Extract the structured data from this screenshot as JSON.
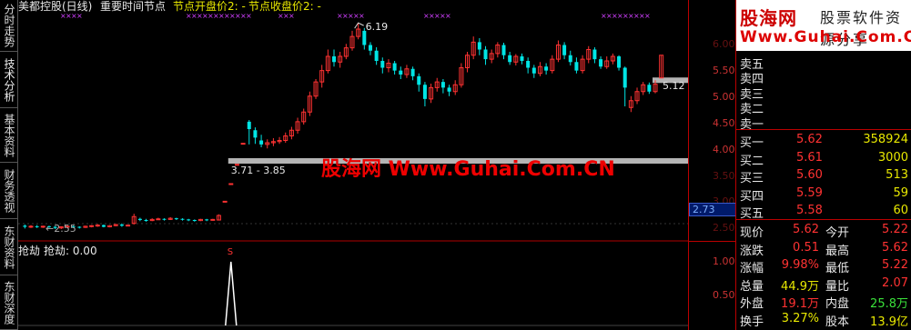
{
  "tabs": [
    {
      "label": "分时走势",
      "active": false
    },
    {
      "label": "技术分析",
      "active": true
    },
    {
      "label": "基本资料",
      "active": false
    },
    {
      "label": "财务透视",
      "active": false
    },
    {
      "label": "东财资料",
      "active": false
    },
    {
      "label": "东财深度",
      "active": false
    }
  ],
  "header": {
    "stock": "美都控股(日线)",
    "indicator": "重要时间节点",
    "open_node": "节点开盘价2: -",
    "close_node": "节点收盘价2: -"
  },
  "sub_header": {
    "name": "抢劫",
    "value": "抢劫: 0.00"
  },
  "annotations": {
    "high": "6.19",
    "low": "2.55",
    "right_mark": "5.12",
    "band_range": "3.71 - 3.85",
    "axis_marker": "2.73",
    "signal": "S"
  },
  "y_ticks": [
    "5.50",
    "5.00",
    "4.50",
    "4.00"
  ],
  "y_ticks_faint": [
    "6.00",
    "3.50",
    "3.00",
    "2.50"
  ],
  "lower_ticks": [
    "1.00",
    "0.50"
  ],
  "watermark": "股海网 Www.Guhai.Com.CN",
  "logo": {
    "title": "股海网",
    "slogan": "股票软件资源分享",
    "url": "Www.Guhai.Com.CN"
  },
  "order_book": {
    "asks": [
      {
        "label": "卖五",
        "price": "",
        "vol": ""
      },
      {
        "label": "卖四",
        "price": "",
        "vol": ""
      },
      {
        "label": "卖三",
        "price": "",
        "vol": ""
      },
      {
        "label": "卖二",
        "price": "",
        "vol": ""
      },
      {
        "label": "卖一",
        "price": "",
        "vol": ""
      }
    ],
    "bids": [
      {
        "label": "买一",
        "price": "5.62",
        "vol": "358924"
      },
      {
        "label": "买二",
        "price": "5.61",
        "vol": "3000"
      },
      {
        "label": "买三",
        "price": "5.60",
        "vol": "513"
      },
      {
        "label": "买四",
        "price": "5.59",
        "vol": "59"
      },
      {
        "label": "买五",
        "price": "5.58",
        "vol": "60"
      }
    ]
  },
  "quote": [
    {
      "l1": "现价",
      "v1": "5.62",
      "l2": "今开",
      "v2": "5.22"
    },
    {
      "l1": "涨跌",
      "v1": "0.51",
      "l2": "最高",
      "v2": "5.62"
    },
    {
      "l1": "涨幅",
      "v1": "9.98%",
      "l2": "最低",
      "v2": "5.22"
    },
    {
      "l1": "总量",
      "v1": "44.9万",
      "l2": "量比",
      "v2": "2.07"
    },
    {
      "l1": "外盘",
      "v1": "19.1万",
      "l2": "内盘",
      "v2": "25.8万"
    },
    {
      "l1": "换手",
      "v1": "3.27%",
      "l2": "股本",
      "v2": "13.9亿"
    }
  ],
  "colors": {
    "up": "#ff3232",
    "down": "#00e5e5",
    "label": "#e8e8e8",
    "axis": "#b00000",
    "yellow": "#e8e800",
    "purple": "#d040ff",
    "gray_band": "#b4b4b4"
  },
  "chart_data": {
    "type": "candlestick",
    "ylim": [
      2.4,
      6.4
    ],
    "candles": [
      {
        "o": 2.62,
        "c": 2.6,
        "h": 2.64,
        "l": 2.57
      },
      {
        "o": 2.6,
        "c": 2.61,
        "h": 2.63,
        "l": 2.58
      },
      {
        "o": 2.61,
        "c": 2.6,
        "h": 2.63,
        "l": 2.58
      },
      {
        "o": 2.6,
        "c": 2.61,
        "h": 2.62,
        "l": 2.58
      },
      {
        "o": 2.61,
        "c": 2.6,
        "h": 2.62,
        "l": 2.58
      },
      {
        "o": 2.6,
        "c": 2.58,
        "h": 2.61,
        "l": 2.56
      },
      {
        "o": 2.58,
        "c": 2.6,
        "h": 2.61,
        "l": 2.56
      },
      {
        "o": 2.6,
        "c": 2.61,
        "h": 2.62,
        "l": 2.58
      },
      {
        "o": 2.61,
        "c": 2.6,
        "h": 2.62,
        "l": 2.58
      },
      {
        "o": 2.6,
        "c": 2.59,
        "h": 2.61,
        "l": 2.57
      },
      {
        "o": 2.59,
        "c": 2.61,
        "h": 2.62,
        "l": 2.58
      },
      {
        "o": 2.61,
        "c": 2.62,
        "h": 2.63,
        "l": 2.59
      },
      {
        "o": 2.62,
        "c": 2.63,
        "h": 2.65,
        "l": 2.6
      },
      {
        "o": 2.63,
        "c": 2.6,
        "h": 2.64,
        "l": 2.59
      },
      {
        "o": 2.6,
        "c": 2.62,
        "h": 2.63,
        "l": 2.59
      },
      {
        "o": 2.62,
        "c": 2.64,
        "h": 2.65,
        "l": 2.61
      },
      {
        "o": 2.64,
        "c": 2.62,
        "h": 2.66,
        "l": 2.6
      },
      {
        "o": 2.62,
        "c": 2.63,
        "h": 2.64,
        "l": 2.61
      },
      {
        "o": 2.66,
        "c": 2.78,
        "h": 2.83,
        "l": 2.64
      },
      {
        "o": 2.74,
        "c": 2.72,
        "h": 2.76,
        "l": 2.7
      },
      {
        "o": 2.72,
        "c": 2.71,
        "h": 2.74,
        "l": 2.69
      },
      {
        "o": 2.71,
        "c": 2.73,
        "h": 2.75,
        "l": 2.7
      },
      {
        "o": 2.73,
        "c": 2.74,
        "h": 2.76,
        "l": 2.72
      },
      {
        "o": 2.74,
        "c": 2.73,
        "h": 2.75,
        "l": 2.71
      },
      {
        "o": 2.73,
        "c": 2.75,
        "h": 2.77,
        "l": 2.72
      },
      {
        "o": 2.75,
        "c": 2.74,
        "h": 2.76,
        "l": 2.72
      },
      {
        "o": 2.74,
        "c": 2.73,
        "h": 2.75,
        "l": 2.71
      },
      {
        "o": 2.73,
        "c": 2.72,
        "h": 2.74,
        "l": 2.7
      },
      {
        "o": 2.72,
        "c": 2.71,
        "h": 2.73,
        "l": 2.69
      },
      {
        "o": 2.71,
        "c": 2.73,
        "h": 2.74,
        "l": 2.7
      },
      {
        "o": 2.73,
        "c": 2.72,
        "h": 2.74,
        "l": 2.7
      },
      {
        "o": 2.72,
        "c": 2.73,
        "h": 2.74,
        "l": 2.71
      },
      {
        "o": 2.72,
        "c": 2.8,
        "h": 2.82,
        "l": 2.71
      },
      {
        "o": 3.05,
        "c": 3.05,
        "h": 3.05,
        "l": 3.05
      },
      {
        "o": 3.36,
        "c": 3.36,
        "h": 3.36,
        "l": 3.36
      },
      {
        "o": 3.7,
        "c": 3.7,
        "h": 3.7,
        "l": 3.7
      },
      {
        "o": 4.07,
        "c": 4.07,
        "h": 4.07,
        "l": 4.07
      },
      {
        "o": 4.45,
        "c": 4.32,
        "h": 4.48,
        "l": 4.05
      },
      {
        "o": 4.3,
        "c": 4.17,
        "h": 4.35,
        "l": 4.06
      },
      {
        "o": 4.12,
        "c": 4.05,
        "h": 4.22,
        "l": 4.0
      },
      {
        "o": 4.05,
        "c": 4.08,
        "h": 4.14,
        "l": 3.98
      },
      {
        "o": 4.08,
        "c": 4.1,
        "h": 4.16,
        "l": 4.02
      },
      {
        "o": 4.1,
        "c": 4.12,
        "h": 4.18,
        "l": 4.06
      },
      {
        "o": 4.12,
        "c": 4.2,
        "h": 4.26,
        "l": 4.08
      },
      {
        "o": 4.2,
        "c": 4.3,
        "h": 4.36,
        "l": 4.14
      },
      {
        "o": 4.3,
        "c": 4.45,
        "h": 4.52,
        "l": 4.24
      },
      {
        "o": 4.45,
        "c": 4.62,
        "h": 4.68,
        "l": 4.4
      },
      {
        "o": 4.62,
        "c": 4.9,
        "h": 4.98,
        "l": 4.55
      },
      {
        "o": 4.9,
        "c": 5.15,
        "h": 5.2,
        "l": 4.85
      },
      {
        "o": 5.15,
        "c": 5.35,
        "h": 5.45,
        "l": 5.05
      },
      {
        "o": 5.35,
        "c": 5.6,
        "h": 5.72,
        "l": 5.3
      },
      {
        "o": 5.6,
        "c": 5.5,
        "h": 5.72,
        "l": 5.42
      },
      {
        "o": 5.5,
        "c": 5.6,
        "h": 5.68,
        "l": 5.4
      },
      {
        "o": 5.6,
        "c": 5.75,
        "h": 5.82,
        "l": 5.55
      },
      {
        "o": 5.75,
        "c": 5.95,
        "h": 6.05,
        "l": 5.7
      },
      {
        "o": 5.95,
        "c": 6.08,
        "h": 6.19,
        "l": 5.9
      },
      {
        "o": 6.05,
        "c": 5.8,
        "h": 6.1,
        "l": 5.72
      },
      {
        "o": 5.8,
        "c": 5.7,
        "h": 5.85,
        "l": 5.62
      },
      {
        "o": 5.7,
        "c": 5.52,
        "h": 5.76,
        "l": 5.45
      },
      {
        "o": 5.52,
        "c": 5.4,
        "h": 5.58,
        "l": 5.3
      },
      {
        "o": 5.4,
        "c": 5.48,
        "h": 5.55,
        "l": 5.32
      },
      {
        "o": 5.48,
        "c": 5.35,
        "h": 5.52,
        "l": 5.28
      },
      {
        "o": 5.35,
        "c": 5.28,
        "h": 5.42,
        "l": 5.2
      },
      {
        "o": 5.28,
        "c": 5.38,
        "h": 5.45,
        "l": 5.22
      },
      {
        "o": 5.38,
        "c": 5.25,
        "h": 5.42,
        "l": 5.18
      },
      {
        "o": 5.25,
        "c": 5.1,
        "h": 5.3,
        "l": 4.98
      },
      {
        "o": 5.1,
        "c": 4.85,
        "h": 5.15,
        "l": 4.72
      },
      {
        "o": 4.85,
        "c": 5.05,
        "h": 5.12,
        "l": 4.78
      },
      {
        "o": 5.05,
        "c": 5.15,
        "h": 5.22,
        "l": 4.98
      },
      {
        "o": 5.15,
        "c": 5.05,
        "h": 5.2,
        "l": 4.95
      },
      {
        "o": 5.05,
        "c": 4.98,
        "h": 5.1,
        "l": 4.9
      },
      {
        "o": 4.98,
        "c": 5.1,
        "h": 5.18,
        "l": 4.92
      },
      {
        "o": 5.1,
        "c": 5.4,
        "h": 5.48,
        "l": 5.05
      },
      {
        "o": 5.4,
        "c": 5.62,
        "h": 5.68,
        "l": 5.32
      },
      {
        "o": 5.62,
        "c": 5.85,
        "h": 5.95,
        "l": 5.55
      },
      {
        "o": 5.85,
        "c": 5.72,
        "h": 5.92,
        "l": 5.62
      },
      {
        "o": 5.72,
        "c": 5.55,
        "h": 5.78,
        "l": 5.45
      },
      {
        "o": 5.55,
        "c": 5.65,
        "h": 5.72,
        "l": 5.48
      },
      {
        "o": 5.65,
        "c": 5.8,
        "h": 5.85,
        "l": 5.58
      },
      {
        "o": 5.8,
        "c": 5.62,
        "h": 5.84,
        "l": 5.55
      },
      {
        "o": 5.62,
        "c": 5.5,
        "h": 5.68,
        "l": 5.45
      },
      {
        "o": 5.5,
        "c": 5.6,
        "h": 5.64,
        "l": 5.44
      },
      {
        "o": 5.6,
        "c": 5.52,
        "h": 5.65,
        "l": 5.46
      },
      {
        "o": 5.52,
        "c": 5.4,
        "h": 5.58,
        "l": 5.3
      },
      {
        "o": 5.4,
        "c": 5.3,
        "h": 5.45,
        "l": 5.22
      },
      {
        "o": 5.3,
        "c": 5.42,
        "h": 5.5,
        "l": 5.25
      },
      {
        "o": 5.42,
        "c": 5.35,
        "h": 5.48,
        "l": 5.28
      },
      {
        "o": 5.35,
        "c": 5.55,
        "h": 5.62,
        "l": 5.3
      },
      {
        "o": 5.55,
        "c": 5.8,
        "h": 5.88,
        "l": 5.5
      },
      {
        "o": 5.8,
        "c": 5.62,
        "h": 5.85,
        "l": 5.55
      },
      {
        "o": 5.62,
        "c": 5.5,
        "h": 5.7,
        "l": 5.44
      },
      {
        "o": 5.5,
        "c": 5.35,
        "h": 5.58,
        "l": 5.3
      },
      {
        "o": 5.35,
        "c": 5.55,
        "h": 5.62,
        "l": 5.3
      },
      {
        "o": 5.55,
        "c": 5.72,
        "h": 5.78,
        "l": 5.48
      },
      {
        "o": 5.72,
        "c": 5.55,
        "h": 5.76,
        "l": 5.48
      },
      {
        "o": 5.55,
        "c": 5.42,
        "h": 5.6,
        "l": 5.38
      },
      {
        "o": 5.42,
        "c": 5.52,
        "h": 5.6,
        "l": 5.38
      },
      {
        "o": 5.52,
        "c": 5.6,
        "h": 5.65,
        "l": 5.46
      },
      {
        "o": 5.6,
        "c": 5.4,
        "h": 5.62,
        "l": 5.35
      },
      {
        "o": 5.4,
        "c": 5.05,
        "h": 5.42,
        "l": 4.72
      },
      {
        "o": 4.7,
        "c": 4.82,
        "h": 4.9,
        "l": 4.62
      },
      {
        "o": 4.82,
        "c": 4.98,
        "h": 5.05,
        "l": 4.76
      },
      {
        "o": 4.98,
        "c": 5.1,
        "h": 5.15,
        "l": 4.92
      },
      {
        "o": 5.1,
        "c": 4.98,
        "h": 5.14,
        "l": 4.94
      },
      {
        "o": 4.98,
        "c": 5.11,
        "h": 5.18,
        "l": 4.95
      },
      {
        "o": 5.22,
        "c": 5.62,
        "h": 5.62,
        "l": 5.22
      }
    ],
    "gray_bands": [
      {
        "price": 3.76,
        "from": 34,
        "to": -1
      },
      {
        "price": 5.18,
        "from": 104,
        "to": -1
      }
    ],
    "signal_spike": {
      "index": 34,
      "value": 1.0
    }
  }
}
